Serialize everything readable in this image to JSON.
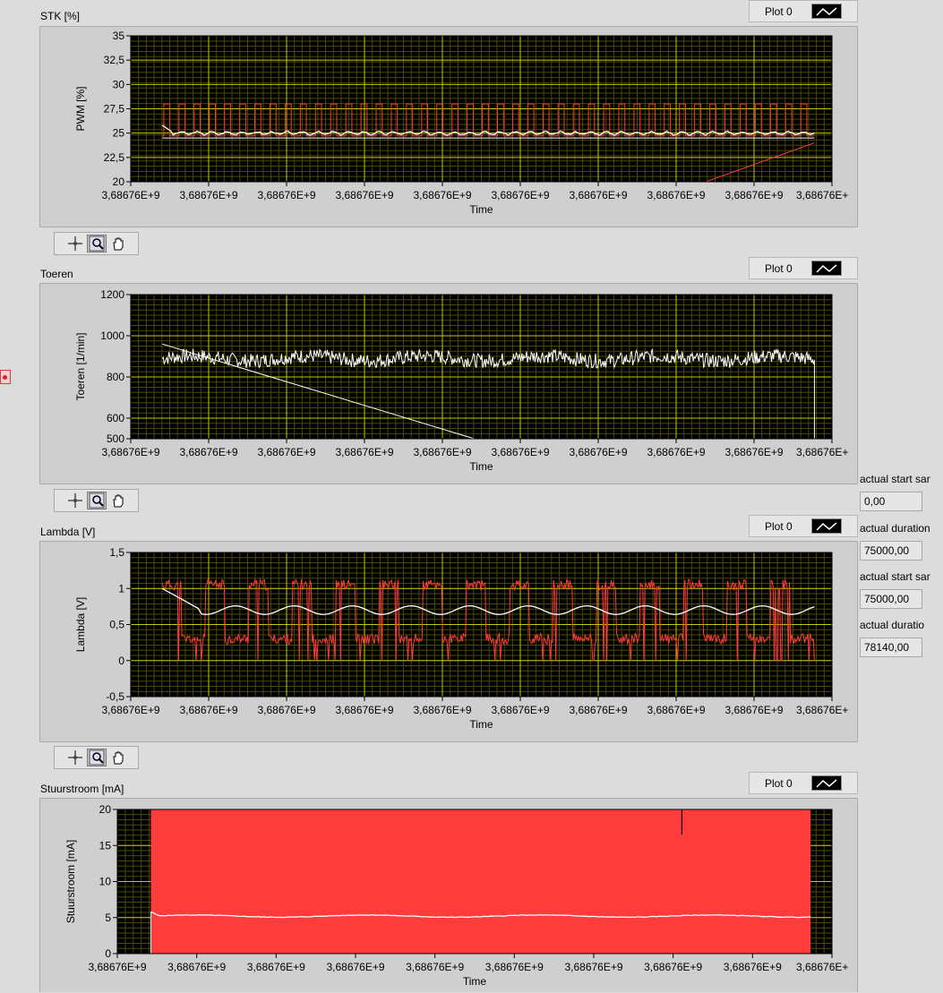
{
  "colors": {
    "plot_bg": "#000000",
    "grid": "#c8c800",
    "red": "#ff3b3b",
    "white": "#ffffff"
  },
  "palette_icons": [
    "crosshair-icon",
    "zoom-icon",
    "hand-pan-icon"
  ],
  "charts": [
    {
      "id": "stk",
      "caption": "STK [%]",
      "legend": "Plot 0"
    },
    {
      "id": "toeren",
      "caption": "Toeren",
      "legend": "Plot 0"
    },
    {
      "id": "lambda",
      "caption": "Lambda [V]",
      "legend": "Plot 0"
    },
    {
      "id": "stuur",
      "caption": "Stuurstroom [mA]",
      "legend": "Plot 0"
    }
  ],
  "indicators": [
    {
      "label": "actual start sar",
      "value": "0,00"
    },
    {
      "label": "actual duration",
      "value": "75000,00"
    },
    {
      "label": "actual start sar",
      "value": "75000,00"
    },
    {
      "label": "actual duratio",
      "value": "78140,00"
    }
  ],
  "chart_data": [
    {
      "type": "line",
      "title": "STK [%]",
      "xlabel": "Time",
      "ylabel": "PWM [%]",
      "ylim": [
        20,
        35
      ],
      "y_ticks": [
        "20",
        "22,5",
        "25",
        "27,5",
        "30",
        "32,5",
        "35"
      ],
      "x_ticks": [
        "3,68676E+9",
        "3,68676E+9",
        "3,68676E+9",
        "3,68676E+9",
        "3,68676E+9",
        "3,68676E+9",
        "3,68676E+9",
        "3,68676E+9",
        "3,68676E+9",
        "3,68676E+"
      ],
      "grid": true,
      "series": [
        {
          "color": "#ff3b3b",
          "description": "square wave between ~24.7 and ~28",
          "high": 28,
          "low": 24.7,
          "cycles": 43
        },
        {
          "color": "#ffffff",
          "description": "slowly oscillating near 25",
          "start": 25.8,
          "mean": 25
        }
      ]
    },
    {
      "type": "line",
      "title": "Toeren",
      "xlabel": "Time",
      "ylabel": "Toeren [1/min]",
      "ylim": [
        500,
        1200
      ],
      "y_ticks": [
        "500",
        "600",
        "800",
        "1000",
        "1200"
      ],
      "x_ticks": [
        "3,68676E+9",
        "3,68676E+9",
        "3,68676E+9",
        "3,68676E+9",
        "3,68676E+9",
        "3,68676E+9",
        "3,68676E+9",
        "3,68676E+9",
        "3,68676E+9",
        "3,68676E+"
      ],
      "grid": true,
      "series": [
        {
          "color": "#ffffff",
          "mean": 890,
          "noise": 35
        }
      ]
    },
    {
      "type": "line",
      "title": "Lambda [V]",
      "xlabel": "Time",
      "ylabel": "Lambda [V]",
      "ylim": [
        -0.5,
        1.5
      ],
      "y_ticks": [
        "-0,5",
        "0",
        "0,5",
        "1",
        "1,5"
      ],
      "x_ticks": [
        "3,68676E+9",
        "3,68676E+9",
        "3,68676E+9",
        "3,68676E+9",
        "3,68676E+9",
        "3,68676E+9",
        "3,68676E+9",
        "3,68676E+9",
        "3,68676E+9",
        "3,68676E+"
      ],
      "grid": true,
      "series": [
        {
          "color": "#ff3b3b",
          "description": "switching between ~0.3 and ~1.05",
          "high": 1.05,
          "low": 0.3
        },
        {
          "color": "#ffffff",
          "description": "average around 0.7",
          "start": 1.0,
          "mean": 0.7
        }
      ]
    },
    {
      "type": "area",
      "title": "Stuurstroom [mA]",
      "xlabel": "Time",
      "ylabel": "Stuurstroom [mA]",
      "ylim": [
        0,
        20
      ],
      "y_ticks": [
        "0",
        "5",
        "10",
        "15",
        "20"
      ],
      "x_ticks": [
        "3,68676E+9",
        "3,68676E+9",
        "3,68676E+9",
        "3,68676E+9",
        "3,68676E+9",
        "3,68676E+9",
        "3,68676E+9",
        "3,68676E+9",
        "3,68676E+9",
        "3,68676E+"
      ],
      "grid": true,
      "series": [
        {
          "color": "#ff3b3b",
          "description": "filled area to 20",
          "value": 20
        },
        {
          "color": "#ffffff",
          "mean": 5.2,
          "start": 5.8
        }
      ]
    }
  ]
}
